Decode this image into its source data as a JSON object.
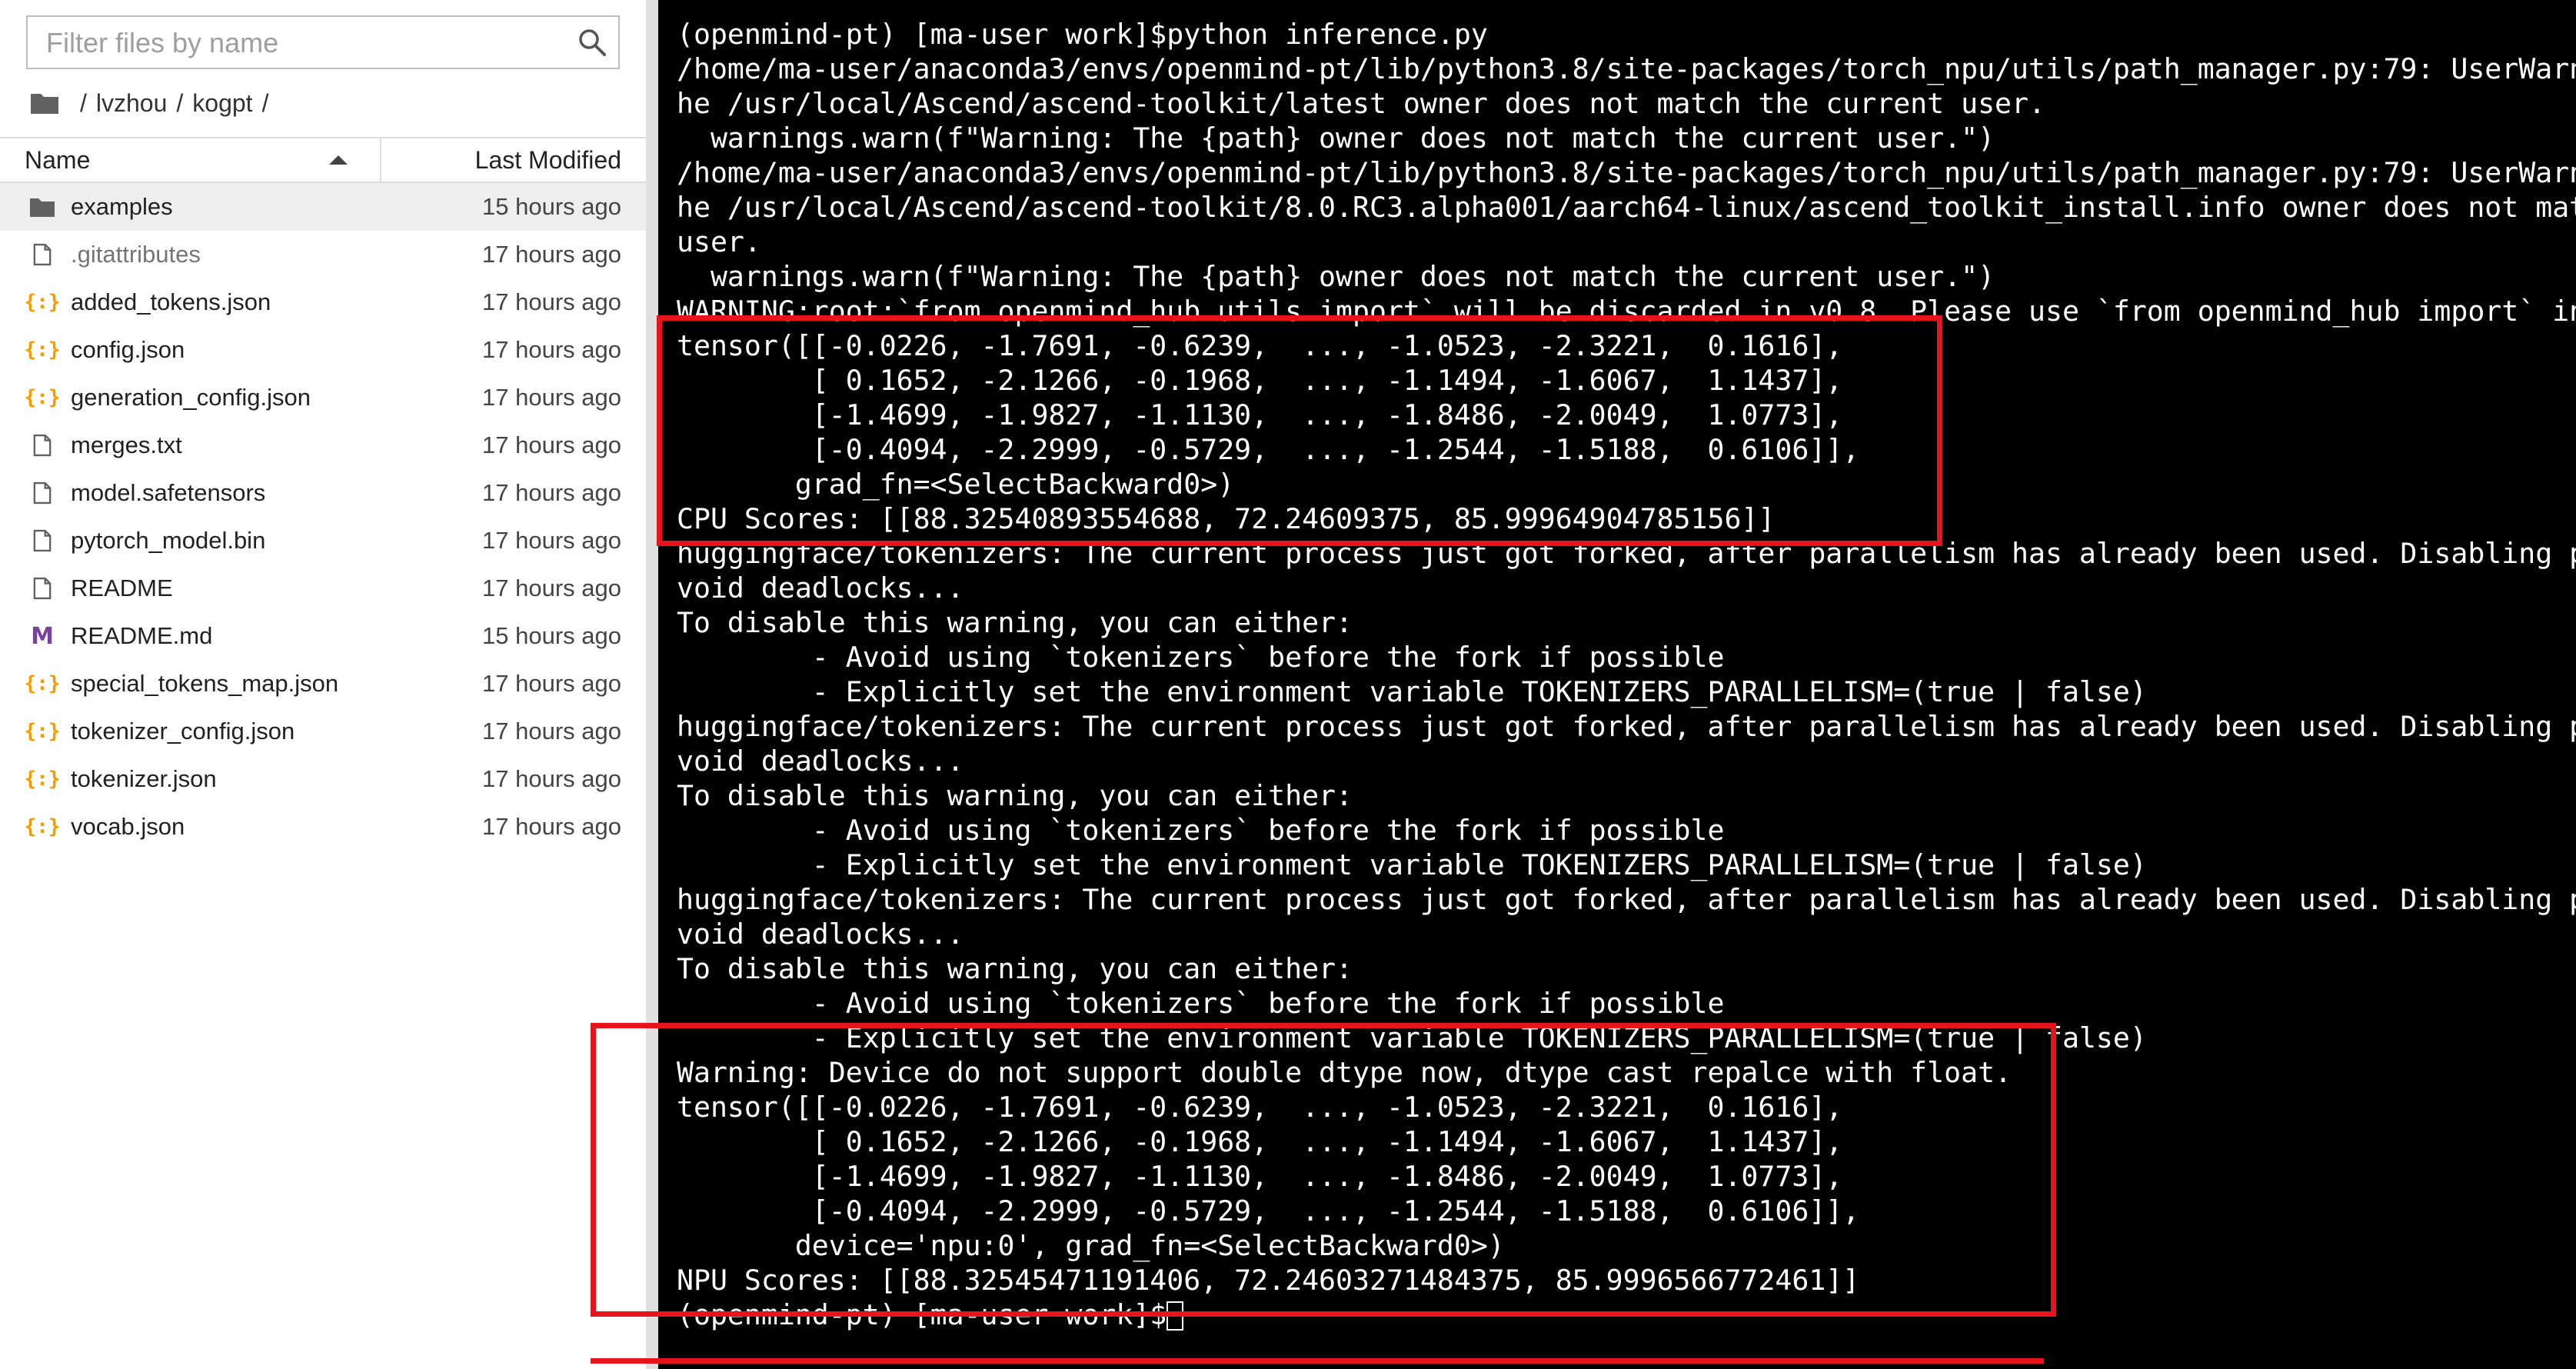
{
  "file_browser": {
    "filter": {
      "placeholder": "Filter files by name"
    },
    "breadcrumb": [
      "lvzhou",
      "kogpt"
    ],
    "columns": {
      "name": "Name",
      "modified": "Last Modified"
    },
    "files": [
      {
        "name": "examples",
        "modified": "15 hours ago",
        "icon": "folder-icon",
        "selected": true
      },
      {
        "name": ".gitattributes",
        "modified": "17 hours ago",
        "icon": "file-icon"
      },
      {
        "name": "added_tokens.json",
        "modified": "17 hours ago",
        "icon": "json-icon"
      },
      {
        "name": "config.json",
        "modified": "17 hours ago",
        "icon": "json-icon"
      },
      {
        "name": "generation_config.json",
        "modified": "17 hours ago",
        "icon": "json-icon"
      },
      {
        "name": "merges.txt",
        "modified": "17 hours ago",
        "icon": "file-icon"
      },
      {
        "name": "model.safetensors",
        "modified": "17 hours ago",
        "icon": "file-icon"
      },
      {
        "name": "pytorch_model.bin",
        "modified": "17 hours ago",
        "icon": "file-icon"
      },
      {
        "name": "README",
        "modified": "17 hours ago",
        "icon": "file-icon"
      },
      {
        "name": "README.md",
        "modified": "15 hours ago",
        "icon": "markdown-icon"
      },
      {
        "name": "special_tokens_map.json",
        "modified": "17 hours ago",
        "icon": "json-icon"
      },
      {
        "name": "tokenizer_config.json",
        "modified": "17 hours ago",
        "icon": "json-icon"
      },
      {
        "name": "tokenizer.json",
        "modified": "17 hours ago",
        "icon": "json-icon"
      },
      {
        "name": "vocab.json",
        "modified": "17 hours ago",
        "icon": "json-icon"
      }
    ]
  },
  "terminal": {
    "lines": [
      "(openmind-pt) [ma-user work]$python inference.py",
      "/home/ma-user/anaconda3/envs/openmind-pt/lib/python3.8/site-packages/torch_npu/utils/path_manager.py:79: UserWarn",
      "he /usr/local/Ascend/ascend-toolkit/latest owner does not match the current user.",
      "  warnings.warn(f\"Warning: The {path} owner does not match the current user.\")",
      "/home/ma-user/anaconda3/envs/openmind-pt/lib/python3.8/site-packages/torch_npu/utils/path_manager.py:79: UserWarn",
      "he /usr/local/Ascend/ascend-toolkit/8.0.RC3.alpha001/aarch64-linux/ascend_toolkit_install.info owner does not mat",
      "user.",
      "  warnings.warn(f\"Warning: The {path} owner does not match the current user.\")",
      "WARNING:root:`from openmind_hub utils import` will be discarded in v0.8. Please use `from openmind_hub import` in",
      "tensor([[-0.0226, -1.7691, -0.6239,  ..., -1.0523, -2.3221,  0.1616],",
      "        [ 0.1652, -2.1266, -0.1968,  ..., -1.1494, -1.6067,  1.1437],",
      "        [-1.4699, -1.9827, -1.1130,  ..., -1.8486, -2.0049,  1.0773],",
      "        [-0.4094, -2.2999, -0.5729,  ..., -1.2544, -1.5188,  0.6106]],",
      "       grad_fn=<SelectBackward0>)",
      "CPU Scores: [[88.32540893554688, 72.24609375, 85.99964904785156]]",
      "huggingface/tokenizers: The current process just got forked, after parallelism has already been used. Disabling p",
      "void deadlocks...",
      "To disable this warning, you can either:",
      "        - Avoid using `tokenizers` before the fork if possible",
      "        - Explicitly set the environment variable TOKENIZERS_PARALLELISM=(true | false)",
      "huggingface/tokenizers: The current process just got forked, after parallelism has already been used. Disabling p",
      "void deadlocks...",
      "To disable this warning, you can either:",
      "        - Avoid using `tokenizers` before the fork if possible",
      "        - Explicitly set the environment variable TOKENIZERS_PARALLELISM=(true | false)",
      "huggingface/tokenizers: The current process just got forked, after parallelism has already been used. Disabling p",
      "void deadlocks...",
      "To disable this warning, you can either:",
      "        - Avoid using `tokenizers` before the fork if possible",
      "        - Explicitly set the environment variable TOKENIZERS_PARALLELISM=(true | false)",
      "Warning: Device do not support double dtype now, dtype cast repalce with float.",
      "tensor([[-0.0226, -1.7691, -0.6239,  ..., -1.0523, -2.3221,  0.1616],",
      "        [ 0.1652, -2.1266, -0.1968,  ..., -1.1494, -1.6067,  1.1437],",
      "        [-1.4699, -1.9827, -1.1130,  ..., -1.8486, -2.0049,  1.0773],",
      "        [-0.4094, -2.2999, -0.5729,  ..., -1.2544, -1.5188,  0.6106]],",
      "       device='npu:0', grad_fn=<SelectBackward0>)",
      "NPU Scores: [[88.32545471191406, 72.24603271484375, 85.9996566772461]]"
    ],
    "prompt": "(openmind-pt) [ma-user work]$"
  },
  "colors": {
    "highlight": "#e8141d",
    "json_icon": "#f59c00",
    "markdown_icon": "#7b3fa0"
  }
}
